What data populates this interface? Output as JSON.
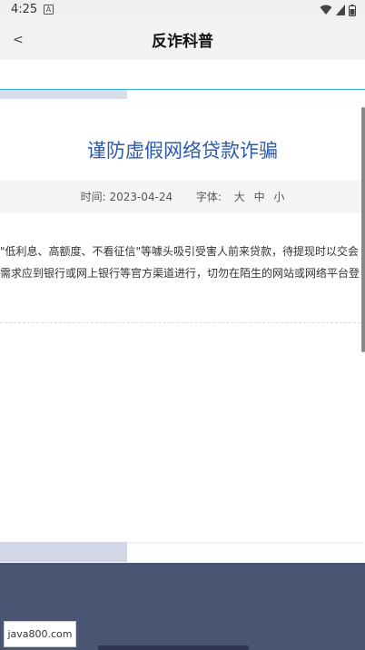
{
  "status": {
    "time": "4:25",
    "notification_letter": "A",
    "icons": [
      "wifi-icon",
      "signal-icon",
      "battery-icon"
    ]
  },
  "header": {
    "back": "<",
    "title": "反诈科普"
  },
  "article": {
    "title": "谨防虚假网络贷款诈骗",
    "time_label": "时间:",
    "date": "2023-04-24",
    "font_label": "字体:",
    "font_sizes": [
      "大",
      "中",
      "小"
    ],
    "paragraph_lines": [
      "\"低利息、高额度、不看征信\"等噱头吸引受害人前来贷款，待提现时以交会",
      "需求应到银行或网上银行等官方渠道进行，切勿在陌生的网站或网络平台登"
    ]
  },
  "watermark": "java800.com",
  "colors": {
    "accent": "#2e5ba8",
    "link_line": "#3aa6dd",
    "footer": "#4a5574"
  }
}
